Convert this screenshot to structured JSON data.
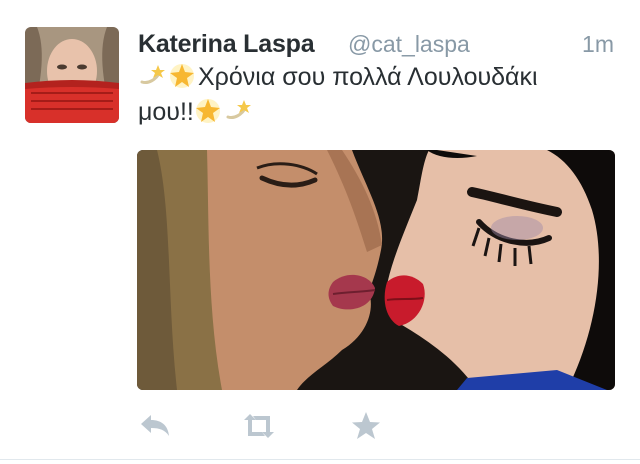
{
  "tweet": {
    "display_name": "Katerina Laspa",
    "handle": "@cat_laspa",
    "timestamp": "1m",
    "text_line1": "Χρόνια σου πολλά Λουλουδάκι",
    "text_line2": "μου!!",
    "emojis": [
      "dizzy-icon",
      "glowing-star-icon",
      "glowing-star-icon",
      "dizzy-icon"
    ]
  },
  "actions": [
    {
      "name": "reply",
      "icon": "reply-icon"
    },
    {
      "name": "retweet",
      "icon": "retweet-icon"
    },
    {
      "name": "favorite",
      "icon": "star-icon"
    }
  ],
  "colors": {
    "name": "#292f33",
    "meta": "#8899a6",
    "action_icon": "#bcc7d0",
    "divider": "#e1e8ed"
  }
}
